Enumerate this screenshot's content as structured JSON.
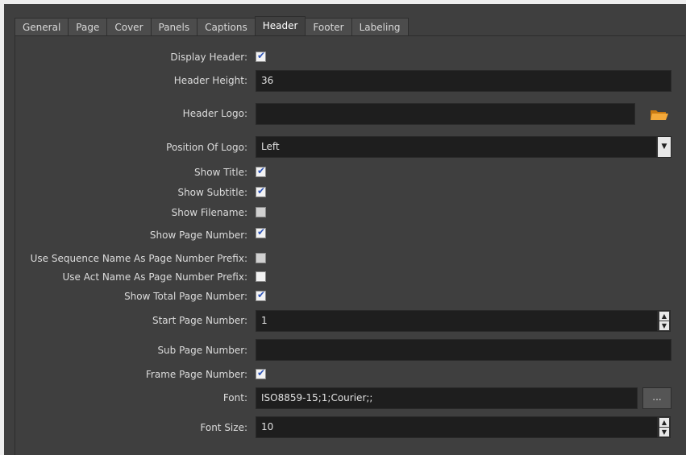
{
  "tabs": [
    "General",
    "Page",
    "Cover",
    "Panels",
    "Captions",
    "Header",
    "Footer",
    "Labeling"
  ],
  "active_tab": "Header",
  "fields": {
    "display_header": {
      "label": "Display Header:",
      "checked": true
    },
    "header_height": {
      "label": "Header Height:",
      "value": "36"
    },
    "header_logo": {
      "label": "Header Logo:",
      "value": "",
      "icon": "folder-icon"
    },
    "position_of_logo": {
      "label": "Position Of Logo:",
      "value": "Left"
    },
    "show_title": {
      "label": "Show Title:",
      "checked": true
    },
    "show_subtitle": {
      "label": "Show Subtitle:",
      "checked": true
    },
    "show_filename": {
      "label": "Show Filename:",
      "checked": false
    },
    "show_page_number": {
      "label": "Show Page Number:",
      "checked": true
    },
    "use_sequence_name": {
      "label": "Use Sequence Name As Page Number Prefix:",
      "checked": false
    },
    "use_act_name": {
      "label": "Use Act Name As Page Number Prefix:",
      "checked": false
    },
    "show_total_page_number": {
      "label": "Show Total Page Number:",
      "checked": true
    },
    "start_page_number": {
      "label": "Start Page Number:",
      "value": "1"
    },
    "sub_page_number": {
      "label": "Sub Page Number:",
      "value": ""
    },
    "frame_page_number": {
      "label": "Frame Page Number:",
      "checked": true
    },
    "font": {
      "label": "Font:",
      "value": "ISO8859-15;1;Courier;;",
      "browse_label": "..."
    },
    "font_size": {
      "label": "Font Size:",
      "value": "10"
    }
  },
  "colors": {
    "background": "#3f3f3f",
    "field": "#1e1e1e",
    "check": "#2f55b8",
    "folder": "#f0a830"
  }
}
